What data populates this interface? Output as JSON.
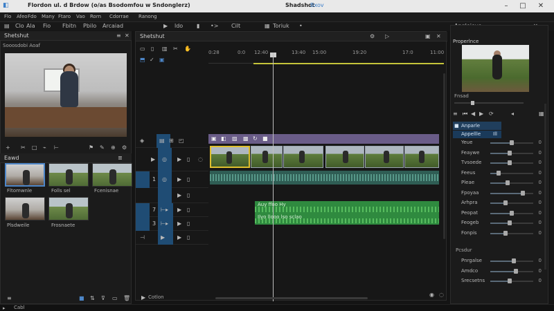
{
  "window": {
    "title": "Flordon ul. d Brdow (o/as Bsodomfou w Sndonglerz)",
    "app_name": "Shadshot",
    "app_suffix": "Bxov"
  },
  "menu": [
    "Flo",
    "Afeo",
    "Fdo",
    "Many",
    "Ftaro",
    "Vao",
    "Rorn",
    "Cdorrae",
    "Ranong"
  ],
  "toolbar": {
    "top_labels": [
      "Clo",
      "Ala",
      "Fio",
      "Fbitn",
      "Pbilo",
      "Arcaiad"
    ],
    "center_items": [
      "ldo",
      "•>",
      "Cilt",
      "Toriuk",
      "•"
    ],
    "right_title": "Angleiove",
    "right_sub": "Properlnce"
  },
  "left_panel": {
    "title": "Shetshut",
    "subtitle": "Sooosdobi  Aoaf",
    "bin_title": "Eawd",
    "thumbs": [
      {
        "label": "Fltomwnle"
      },
      {
        "label": "Folls sel"
      },
      {
        "label": "Fcenisnae"
      },
      {
        "label": "Plsdweile"
      },
      {
        "label": "Frosnaete"
      }
    ]
  },
  "timeline": {
    "title": "Shetshut",
    "ruler": [
      "0:28",
      "0:0",
      "12:40",
      "13:40",
      "15:00",
      "19:20",
      "17:0",
      "11:00"
    ],
    "tracks": [
      {
        "num": "",
        "kind": "video"
      },
      {
        "num": "1",
        "kind": "audio"
      },
      {
        "num": "",
        "kind": "empty"
      },
      {
        "num": "7",
        "kind": "audio"
      },
      {
        "num": "3",
        "kind": "audio"
      },
      {
        "num": "",
        "kind": "empty"
      }
    ],
    "clip_label_a": "Auy ffoo  Hy",
    "clip_label_b": "Ilyo llooo lso sclao",
    "footer": "Cotlon"
  },
  "right_panel": {
    "preview_caption": "Fnsad",
    "section_title": "Anparle",
    "section_sub": "Appellle",
    "sub_badge": "Ill",
    "sliders": [
      {
        "label": "Yeue",
        "value": "0",
        "pos": 0.5
      },
      {
        "label": "Feaywe",
        "value": "0",
        "pos": 0.45
      },
      {
        "label": "Tvsoede",
        "value": "0",
        "pos": 0.45
      },
      {
        "label": "Feeus",
        "value": "0",
        "pos": 0.2
      },
      {
        "label": "Pleae",
        "value": "0",
        "pos": 0.4
      },
      {
        "label": "Fpoyaa",
        "value": "0",
        "pos": 0.75
      },
      {
        "label": "Arhpra",
        "value": "0",
        "pos": 0.35
      },
      {
        "label": "Peopat",
        "value": "0",
        "pos": 0.5
      },
      {
        "label": "Feogeb",
        "value": "0",
        "pos": 0.45
      },
      {
        "label": "Fonpis",
        "value": "0",
        "pos": 0.35
      }
    ],
    "section2": "Pcsdur",
    "sliders2": [
      {
        "label": "Pnrgalse",
        "value": "0",
        "pos": 0.55
      },
      {
        "label": "Amdco",
        "value": "0",
        "pos": 0.6
      },
      {
        "label": "Srecsetns",
        "value": "0",
        "pos": 0.45
      }
    ]
  },
  "status": {
    "left": "Cabl"
  },
  "colors": {
    "accent": "#4d86c8",
    "selected_track": "#1f4c74",
    "purple_strip": "#6a5c88",
    "audio_teal": "#2f5d54",
    "audio_green": "#2f8a3f",
    "work_area": "#c5c43a"
  }
}
